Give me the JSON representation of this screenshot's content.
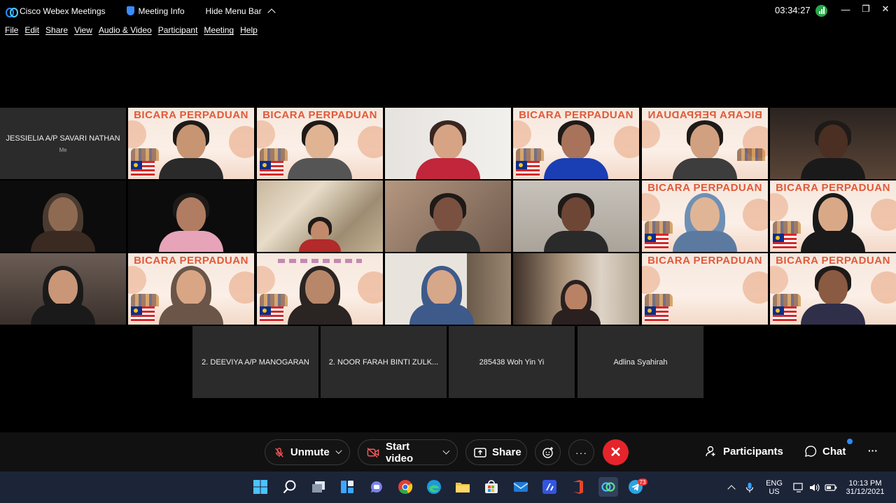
{
  "titlebar": {
    "app": "Cisco Webex Meetings",
    "meeting_info": "Meeting Info",
    "hide_menu": "Hide Menu Bar",
    "timer": "03:34:27"
  },
  "menu": [
    "File",
    "Edit",
    "Share",
    "View",
    "Audio & Video",
    "Participant",
    "Meeting",
    "Help"
  ],
  "self_tile": {
    "name": "JESSIELIA A/P SAVARI NATHAN",
    "sub": "Me"
  },
  "poster_text": "BICARA PERPADUAN",
  "name_tiles": [
    "2. DEEVIYA A/P MANOGARAN",
    "2. NOOR FARAH BINTI ZULK...",
    "285438 Woh Yin Yi",
    "Adlina Syahirah"
  ],
  "controls": {
    "unmute": "Unmute",
    "start_video": "Start video",
    "share": "Share",
    "participants": "Participants",
    "chat": "Chat"
  },
  "taskbar": {
    "lang": "ENG",
    "region": "US",
    "time": "10:13 PM",
    "date": "31/12/2021",
    "badge": "73"
  },
  "colors": {
    "end_call": "#e5242b",
    "accent": "#2c8cff",
    "taskbar": "#1c2438"
  }
}
